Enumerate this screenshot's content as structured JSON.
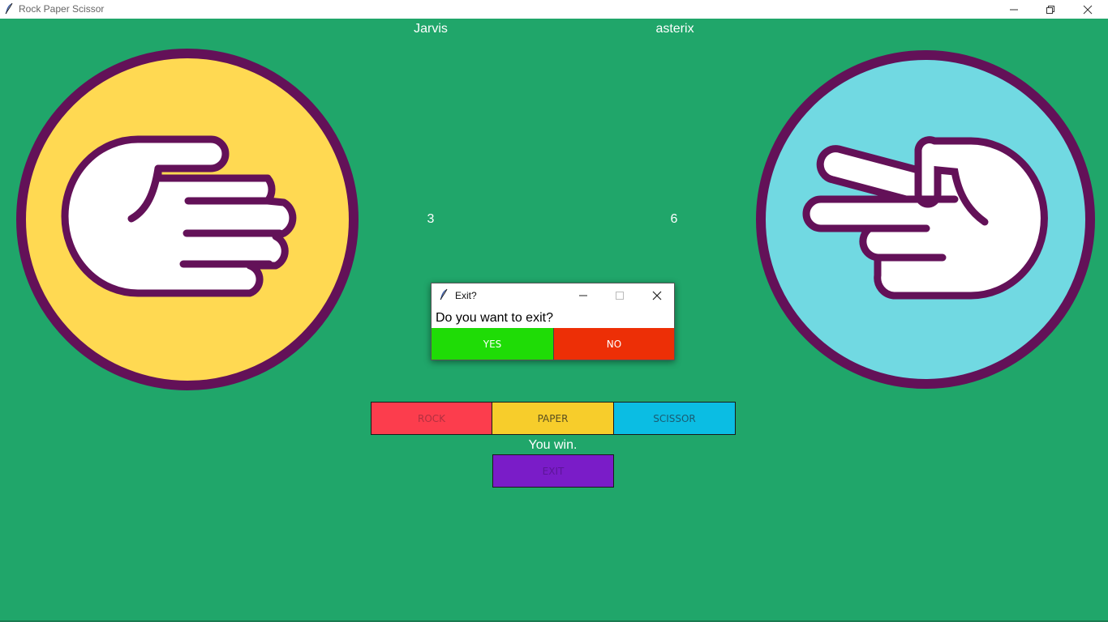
{
  "window": {
    "title": "Rock Paper Scissor"
  },
  "players": {
    "left": {
      "name": "Jarvis",
      "score": "3",
      "hand": "paper"
    },
    "right": {
      "name": "asterix",
      "score": "6",
      "hand": "scissor"
    }
  },
  "controls": {
    "rock_label": "ROCK",
    "paper_label": "PAPER",
    "scissor_label": "SCISSOR",
    "exit_label": "EXIT"
  },
  "result_text": "You win.",
  "dialog": {
    "title": "Exit?",
    "message": "Do you want to exit?",
    "yes_label": "YES",
    "no_label": "NO"
  },
  "colors": {
    "background": "#20a66a",
    "rock": "#fc3d4d",
    "paper": "#f7cd2b",
    "scissor": "#0bbde3",
    "exit": "#7a1cc8",
    "yes": "#1fdc06",
    "no": "#ed2f06",
    "hand_outline": "#631158",
    "left_circle": "#ffd952",
    "right_circle": "#71d9e2"
  },
  "icons": {
    "app": "feather-icon",
    "left_hand": "paper-hand-icon",
    "right_hand": "scissor-hand-icon"
  }
}
